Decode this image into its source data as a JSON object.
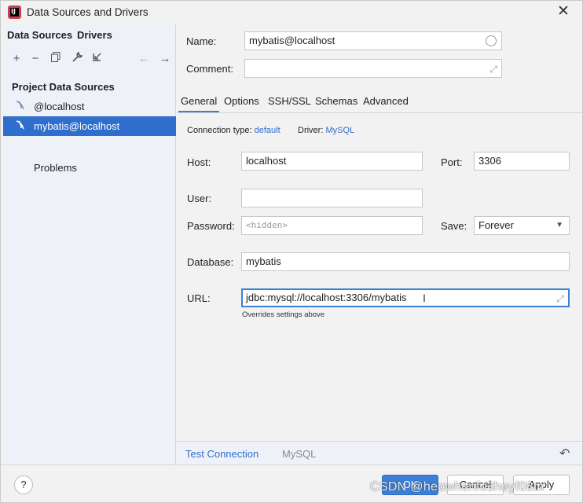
{
  "window": {
    "title": "Data Sources and Drivers"
  },
  "sidebar": {
    "tabs": [
      "Data Sources",
      "Drivers"
    ],
    "group_title": "Project Data Sources",
    "items": [
      {
        "label": "@localhost",
        "selected": false
      },
      {
        "label": "mybatis@localhost",
        "selected": true
      }
    ],
    "problems_label": "Problems"
  },
  "form": {
    "name_label": "Name:",
    "name_value": "mybatis@localhost",
    "comment_label": "Comment:",
    "comment_value": ""
  },
  "tabs": [
    "General",
    "Options",
    "SSH/SSL",
    "Schemas",
    "Advanced"
  ],
  "active_tab": "General",
  "connection": {
    "type_label": "Connection type:",
    "type_value": "default",
    "driver_label": "Driver:",
    "driver_value": "MySQL"
  },
  "fields": {
    "host_label": "Host:",
    "host_value": "localhost",
    "port_label": "Port:",
    "port_value": "3306",
    "user_label": "User:",
    "user_value": "",
    "password_label": "Password:",
    "password_placeholder": "<hidden>",
    "save_label": "Save:",
    "save_value": "Forever",
    "database_label": "Database:",
    "database_value": "mybatis",
    "url_label": "URL:",
    "url_value": "jdbc:mysql://localhost:3306/mybatis",
    "url_hint": "Overrides settings above"
  },
  "footer": {
    "test_connection": "Test Connection",
    "driver_name": "MySQL"
  },
  "buttons": {
    "help": "?",
    "ok": "OK",
    "cancel": "Cancel",
    "apply": "Apply"
  },
  "watermark": "CSDN @heowhenfo3heyf08m",
  "colors": {
    "accent": "#3d7fd6",
    "selection": "#2f6ecc",
    "link": "#2f6ecc"
  }
}
